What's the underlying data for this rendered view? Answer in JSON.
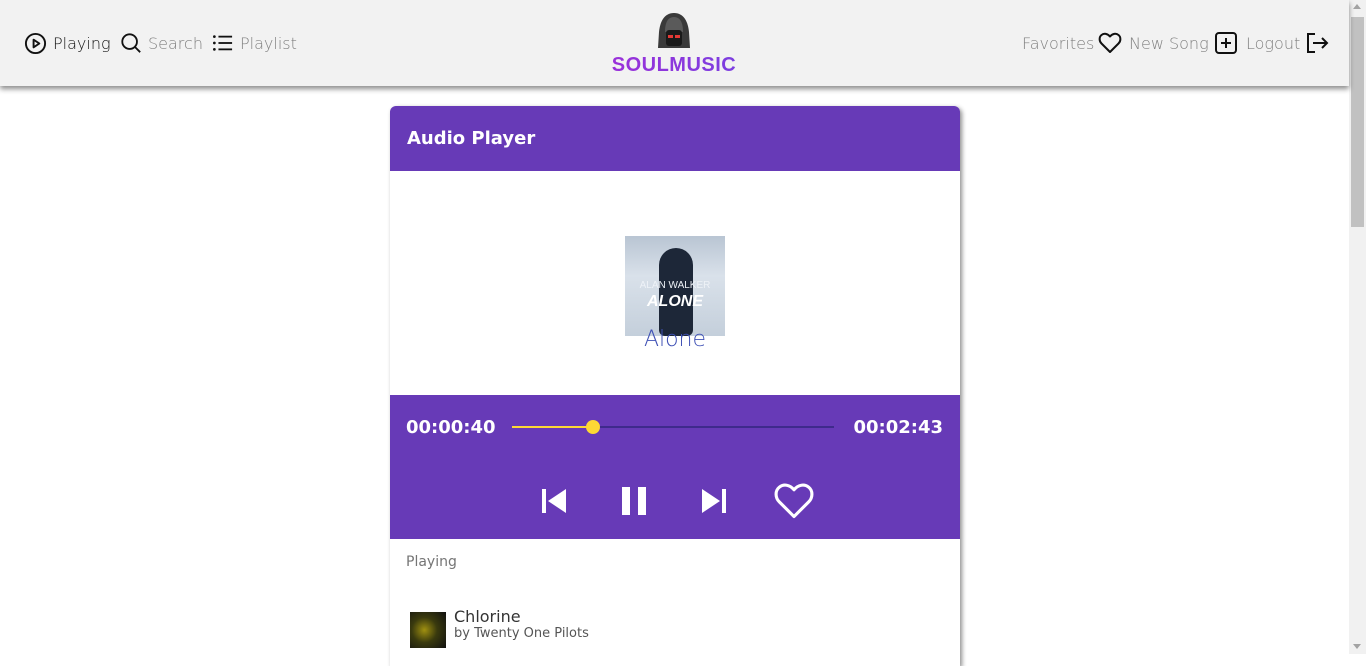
{
  "nav": {
    "playing": "Playing",
    "search": "Search",
    "playlist": "Playlist",
    "favorites": "Favorites",
    "new_song": "New Song",
    "logout": "Logout"
  },
  "logo": {
    "text": "SOULMUSIC",
    "icon": "hooded-head-icon"
  },
  "player": {
    "title": "Audio Player",
    "cover": {
      "artist": "ALAN WALKER",
      "title": "ALONE"
    },
    "song_title": "Alone",
    "current_time": "00:00:40",
    "total_time": "00:02:43",
    "progress": 0.25
  },
  "queue": {
    "label": "Playing",
    "items": [
      {
        "title": "Chlorine",
        "artist": "by Twenty One Pilots"
      }
    ]
  },
  "colors": {
    "accent": "#673ab7",
    "progress": "#fdd835",
    "song_title": "#3f51b5"
  }
}
